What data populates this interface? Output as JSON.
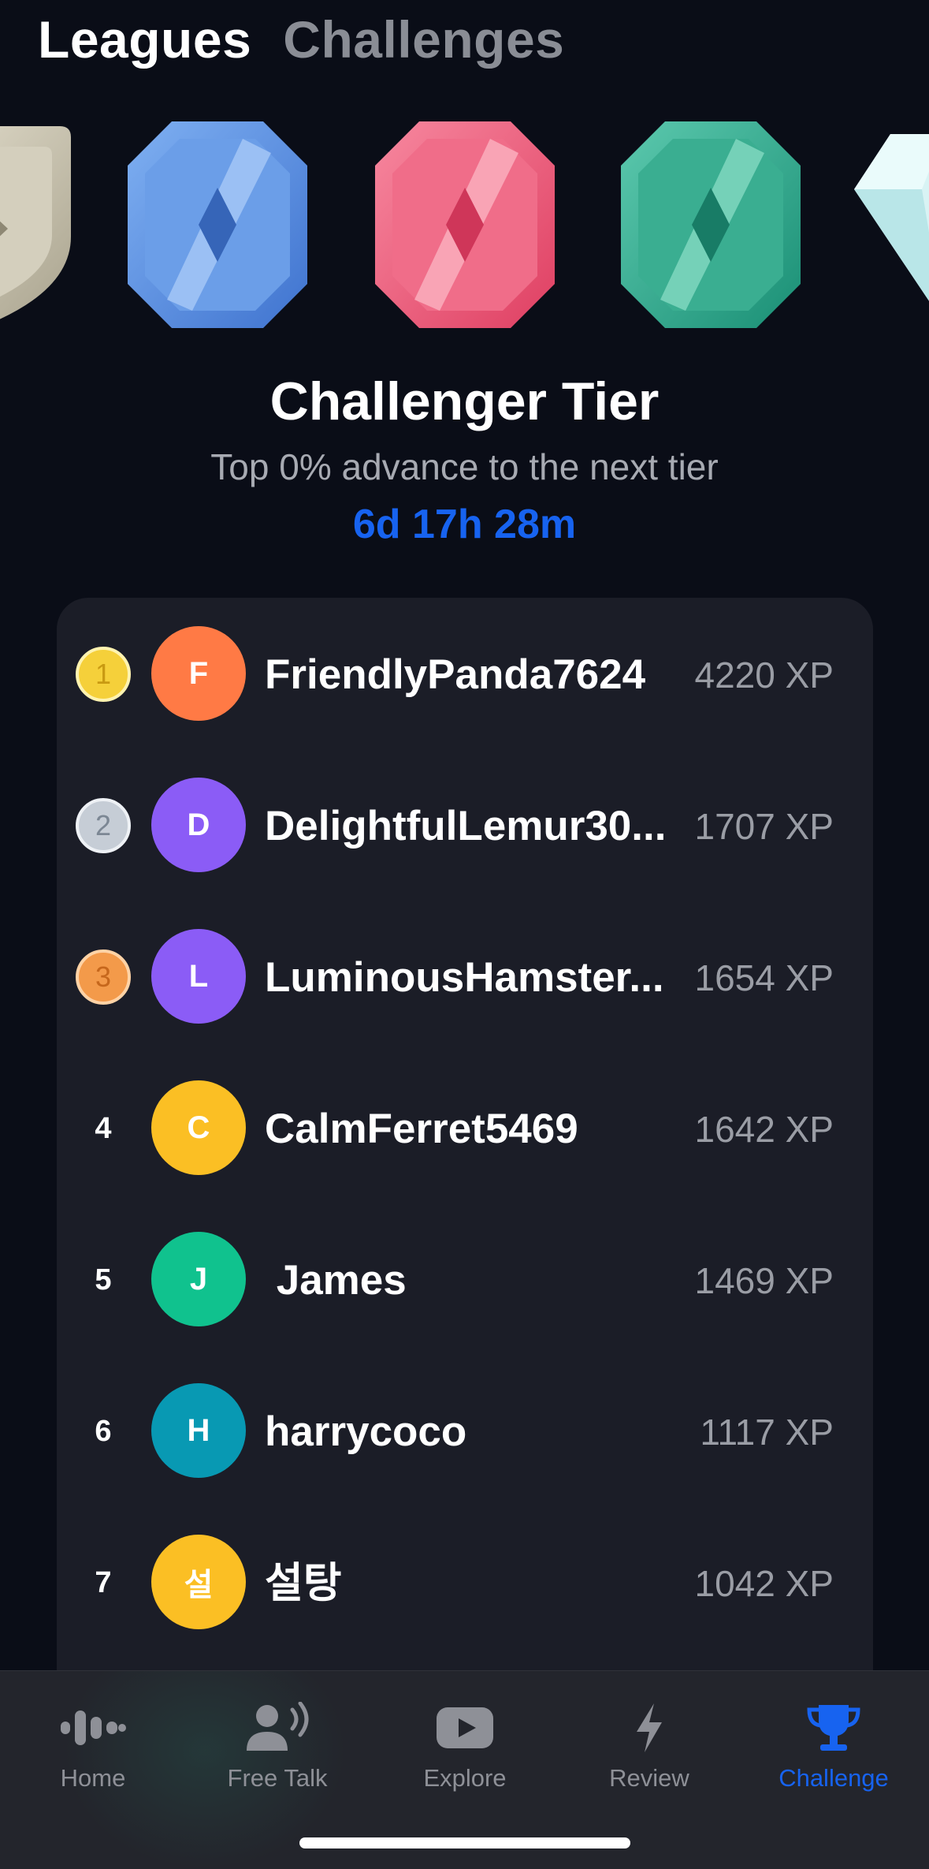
{
  "tabs": {
    "leagues": "Leagues",
    "challenges": "Challenges"
  },
  "badges": [
    {
      "name": "stone-badge",
      "color": "#c9c4b2"
    },
    {
      "name": "sapphire-badge",
      "color": "#4f8be3"
    },
    {
      "name": "ruby-badge",
      "color": "#ea5a79"
    },
    {
      "name": "emerald-badge",
      "color": "#2ea98d"
    },
    {
      "name": "diamond-badge",
      "color": "#cfeff0"
    }
  ],
  "tier": {
    "title": "Challenger Tier",
    "subtitle": "Top 0% advance to the next tier",
    "timer": "6d 17h 28m"
  },
  "leaderboard": [
    {
      "rank": "1",
      "medal": "gold",
      "initial": "F",
      "name": "FriendlyPanda7624",
      "xp": "4220 XP",
      "avatar_color": "#ff7a45"
    },
    {
      "rank": "2",
      "medal": "silver",
      "initial": "D",
      "name": "DelightfulLemur30...",
      "xp": "1707 XP",
      "avatar_color": "#8b5cf6"
    },
    {
      "rank": "3",
      "medal": "bronze",
      "initial": "L",
      "name": "LuminousHamster...",
      "xp": "1654 XP",
      "avatar_color": "#8b5cf6"
    },
    {
      "rank": "4",
      "medal": "",
      "initial": "C",
      "name": "CalmFerret5469",
      "xp": "1642 XP",
      "avatar_color": "#fbbf24"
    },
    {
      "rank": "5",
      "medal": "",
      "initial": "J",
      "name": " James",
      "xp": "1469 XP",
      "avatar_color": "#10c28e"
    },
    {
      "rank": "6",
      "medal": "",
      "initial": "H",
      "name": "harrycoco",
      "xp": "1117 XP",
      "avatar_color": "#0899b3"
    },
    {
      "rank": "7",
      "medal": "",
      "initial": "설",
      "name": "설탕",
      "xp": "1042 XP",
      "avatar_color": "#fbbf24"
    }
  ],
  "nav": {
    "home": "Home",
    "free_talk": "Free Talk",
    "explore": "Explore",
    "review": "Review",
    "challenge": "Challenge"
  },
  "colors": {
    "accent": "#1763f0",
    "background": "#0a0d17",
    "card": "#1b1d27",
    "gold": "#f5d03a",
    "silver": "#c6cdd6",
    "bronze": "#f39a4a"
  }
}
